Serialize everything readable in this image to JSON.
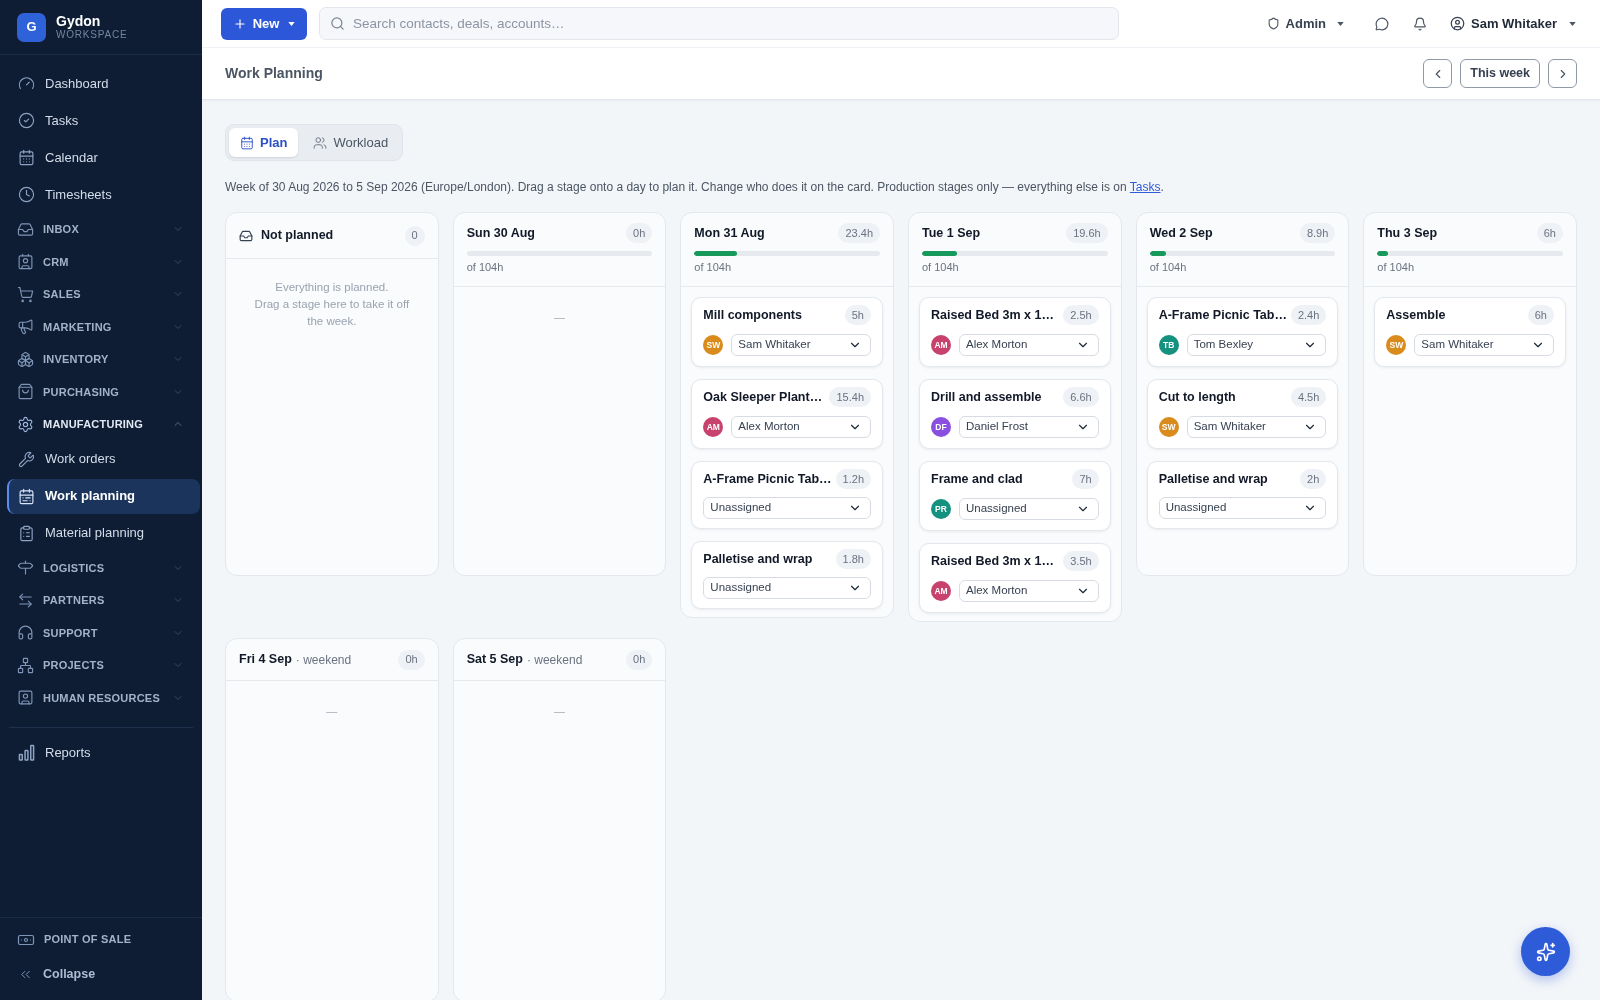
{
  "sidebar": {
    "brand": {
      "logo": "G",
      "name": "Gydon",
      "subtitle": "WORKSPACE"
    },
    "items": [
      {
        "kind": "link",
        "label": "Dashboard",
        "selected": false
      },
      {
        "kind": "link",
        "label": "Tasks",
        "selected": false
      },
      {
        "kind": "link",
        "label": "Calendar",
        "selected": false
      },
      {
        "kind": "link",
        "label": "Timesheets",
        "selected": false
      },
      {
        "kind": "section",
        "label": "INBOX",
        "expanded": false
      },
      {
        "kind": "section",
        "label": "CRM",
        "expanded": false
      },
      {
        "kind": "section",
        "label": "SALES",
        "expanded": false
      },
      {
        "kind": "section",
        "label": "MARKETING",
        "expanded": false
      },
      {
        "kind": "section",
        "label": "INVENTORY",
        "expanded": false
      },
      {
        "kind": "section",
        "label": "PURCHASING",
        "expanded": false
      },
      {
        "kind": "section",
        "label": "MANUFACTURING",
        "expanded": true,
        "children": [
          {
            "kind": "link",
            "label": "Work orders",
            "selected": false
          },
          {
            "kind": "link",
            "label": "Work planning",
            "selected": true
          },
          {
            "kind": "link",
            "label": "Material planning",
            "selected": false
          }
        ]
      },
      {
        "kind": "section",
        "label": "LOGISTICS",
        "expanded": false
      },
      {
        "kind": "section",
        "label": "PARTNERS",
        "expanded": false
      },
      {
        "kind": "section",
        "label": "SUPPORT",
        "expanded": false
      },
      {
        "kind": "section",
        "label": "PROJECTS",
        "expanded": false
      },
      {
        "kind": "section",
        "label": "HUMAN RESOURCES",
        "expanded": false
      }
    ],
    "more_items": [
      {
        "kind": "link",
        "label": "Reports",
        "selected": false
      }
    ],
    "footer": [
      {
        "kind": "heading",
        "label": "POINT OF SALE"
      },
      {
        "kind": "collapse",
        "label": "Collapse"
      }
    ]
  },
  "top_bar": {
    "new_button": "New",
    "search": {
      "placeholder": "Search contacts, deals, accounts…"
    },
    "role_menu": "Admin",
    "user_menu": "Sam Whitaker"
  },
  "page_header": {
    "title": "Work Planning",
    "week_button": "This week"
  },
  "view_tabs": [
    {
      "label": "Plan",
      "selected": true
    },
    {
      "label": "Workload",
      "selected": false
    }
  ],
  "description": {
    "text": "Week of 30 Aug 2026 to 5 Sep 2026 (Europe/London). Drag a stage onto a day to plan it. Change who does it on the card. Production stages only — everything else is on",
    "link": "Tasks",
    "after": "."
  },
  "board": {
    "columns": [
      {
        "kind": "backlog",
        "title": "Not planned",
        "count": "0",
        "empty_lines": [
          "Everything is planned.",
          "Drag a stage here to take it off the week."
        ]
      },
      {
        "kind": "day",
        "title": "Sun 30 Aug",
        "total": "0h",
        "capacity": "of 104h",
        "empty_mark": "—"
      },
      {
        "kind": "day",
        "title": "Mon 31 Aug",
        "total": "23.4h",
        "level": 0.23,
        "capacity": "of 104h",
        "cards": [
          {
            "title": "Mill components",
            "hours": "5h",
            "assignee": {
              "initials": "SW",
              "color": "#d98b1c"
            },
            "select": "Sam Whitaker"
          },
          {
            "title": "Oak Sleeper Plant…",
            "hours": "15.4h",
            "assignee": {
              "initials": "AM",
              "color": "#c8426e"
            },
            "select": "Alex Morton"
          },
          {
            "title": "A-Frame Picnic Tab…",
            "hours": "1.2h",
            "select": "Unassigned"
          },
          {
            "title": "Palletise and wrap",
            "hours": "1.8h",
            "select": "Unassigned"
          }
        ]
      },
      {
        "kind": "day",
        "title": "Tue 1 Sep",
        "total": "19.6h",
        "level": 0.19,
        "capacity": "of 104h",
        "cards": [
          {
            "title": "Raised Bed 3m x 1…",
            "hours": "2.5h",
            "assignee": {
              "initials": "AM",
              "color": "#c8426e"
            },
            "select": "Alex Morton"
          },
          {
            "title": "Drill and assemble",
            "hours": "6.6h",
            "assignee": {
              "initials": "DF",
              "color": "#8b4fe0"
            },
            "select": "Daniel Frost"
          },
          {
            "title": "Frame and clad",
            "hours": "7h",
            "assignee": {
              "initials": "PR",
              "color": "#14917f"
            },
            "select": "Unassigned"
          },
          {
            "title": "Raised Bed 3m x 1…",
            "hours": "3.5h",
            "assignee": {
              "initials": "AM",
              "color": "#c8426e"
            },
            "select": "Alex Morton"
          }
        ]
      },
      {
        "kind": "day",
        "title": "Wed 2 Sep",
        "total": "8.9h",
        "level": 0.09,
        "capacity": "of 104h",
        "cards": [
          {
            "title": "A-Frame Picnic Tab…",
            "hours": "2.4h",
            "assignee": {
              "initials": "TB",
              "color": "#14917f"
            },
            "select": "Tom Bexley"
          },
          {
            "title": "Cut to length",
            "hours": "4.5h",
            "assignee": {
              "initials": "SW",
              "color": "#d98b1c"
            },
            "select": "Sam Whitaker"
          },
          {
            "title": "Palletise and wrap",
            "hours": "2h",
            "select": "Unassigned"
          }
        ]
      },
      {
        "kind": "day",
        "title": "Thu 3 Sep",
        "total": "6h",
        "level": 0.06,
        "capacity": "of 104h",
        "cards": [
          {
            "title": "Assemble",
            "hours": "6h",
            "assignee": {
              "initials": "SW",
              "color": "#d98b1c"
            },
            "select": "Sam Whitaker"
          }
        ]
      },
      {
        "kind": "weekend",
        "title": "Fri 4 Sep",
        "note": "· weekend",
        "total": "0h",
        "empty_mark": "—"
      },
      {
        "kind": "weekend",
        "title": "Sat 5 Sep",
        "note": "· weekend",
        "total": "0h",
        "empty_mark": "—"
      }
    ]
  }
}
